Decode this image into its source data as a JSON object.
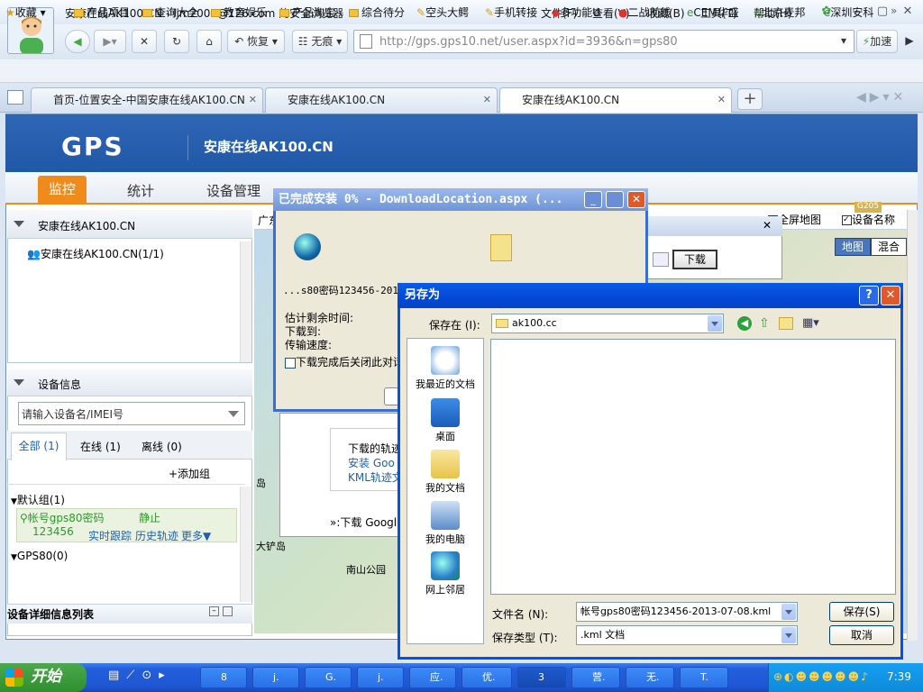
{
  "browser": {
    "title": "安康在线AK100.CN - ljm2009@126.com 的安全浏览器",
    "menu": [
      "文件(F)",
      "查看(V)",
      "收藏(B)",
      "工具(T)",
      "帮助(H)"
    ],
    "nav_back": "",
    "restore_label": "恢复",
    "no_trace_label": "无痕",
    "url": "http://gps.gps10.net/user.aspx?id=3936&n=gps80",
    "accelerate_label": "加速",
    "bookmarks": [
      "收藏",
      "产品项目",
      "查询大全",
      "教育娱乐",
      "产品淘宝",
      "综合待分",
      "空头大鳄",
      "手机转接",
      "多功能U",
      "二战前线",
      "CEM华盛",
      "北京麦邦",
      "深圳安科"
    ],
    "tabs": [
      "首页-位置安全-中国安康在线AK100.CN",
      "安康在线AK100.CN",
      "安康在线AK100.CN"
    ]
  },
  "site": {
    "logo": "GPS",
    "name": "安康在线AK100.CN",
    "nav": [
      "监控",
      "统计",
      "设备管理"
    ],
    "tree_title": "安康在线AK100.CN",
    "tree_item": "安康在线AK100.CN(1/1)",
    "device_info_title": "设备信息",
    "device_search_placeholder": "请输入设备名/IMEI号",
    "filter_tabs": [
      "全部 (1)",
      "在线 (1)",
      "离线 (0)"
    ],
    "add_group": "+添加组",
    "default_group": "默认组(1)",
    "device_name": "帐号gps80密码",
    "device_pwd": "123456",
    "device_status": "静止",
    "device_links": [
      "实时跟踪",
      "历史轨迹",
      "更多▼"
    ],
    "gps80_group": "GPS80(0)",
    "detail_list": "设备详细信息列表",
    "map_left_label": "广东",
    "fullscreen_map": "全屏地图",
    "device_name_check": "设备名称",
    "map_btn": "地图",
    "hybrid_btn": "混合",
    "download_btn": "下载",
    "map_label_1": "大铲岛",
    "map_label_2": "南山公园",
    "map_label_3": "岛",
    "popup_lines": [
      "下载的轨迹",
      "安装 Goo",
      "KML轨迹文"
    ],
    "popup_link": "»:下载 Googl",
    "map_road": "G205"
  },
  "download_dialog": {
    "title": "已完成安装 0% - DownloadLocation.aspx (...",
    "filename": "...s80密码123456-2013-",
    "remaining_label": "估计剩余时间:",
    "download_to_label": "下载到:",
    "speed_label": "传输速度:",
    "close_when_done": "下载完成后关闭此对话"
  },
  "save_dialog": {
    "title": "另存为",
    "save_in_label": "保存在 (I):",
    "save_in_value": "ak100.cc",
    "places": [
      "我最近的文档",
      "桌面",
      "我的文档",
      "我的电脑",
      "网上邻居"
    ],
    "filename_label": "文件名 (N):",
    "filename_value": "帐号gps80密码123456-2013-07-08.kml",
    "filetype_label": "保存类型 (T):",
    "filetype_value": ".kml 文档",
    "save_button": "保存(S)",
    "cancel_button": "取消"
  },
  "taskbar": {
    "start": "开始",
    "items": [
      "8",
      "j.",
      "G.",
      "j.",
      "应.",
      "优.",
      "3",
      "营.",
      "无.",
      "T."
    ],
    "clock": "7:39"
  }
}
